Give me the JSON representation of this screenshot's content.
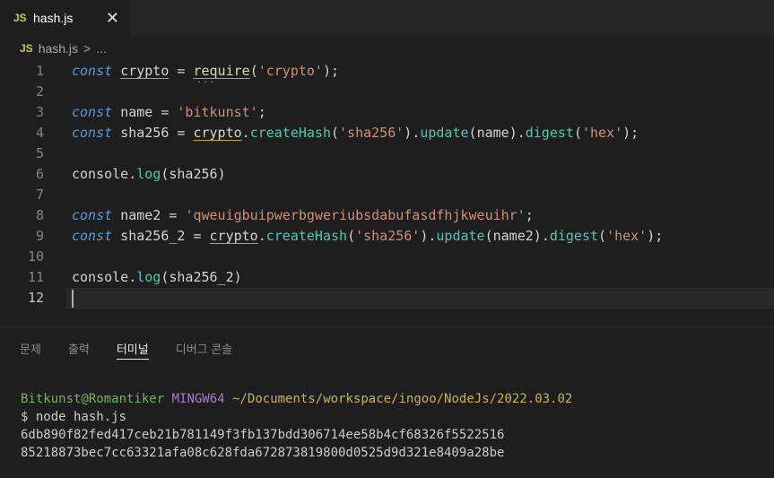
{
  "tab": {
    "badge": "JS",
    "title": "hash.js",
    "close": "✕"
  },
  "breadcrumb": {
    "badge": "JS",
    "file": "hash.js",
    "sep": ">",
    "more": "..."
  },
  "editor": {
    "lines": [
      {
        "n": "1"
      },
      {
        "n": "2"
      },
      {
        "n": "3"
      },
      {
        "n": "4"
      },
      {
        "n": "5"
      },
      {
        "n": "6"
      },
      {
        "n": "7"
      },
      {
        "n": "8"
      },
      {
        "n": "9"
      },
      {
        "n": "10"
      },
      {
        "n": "11"
      },
      {
        "n": "12"
      }
    ],
    "tokens": {
      "const": "const",
      "crypto": "crypto",
      "eq": " = ",
      "require": "require",
      "lp": "(",
      "rp": ")",
      "semi": ";",
      "str_crypto": "'crypto'",
      "name": "name",
      "str_bitkunst": "'bitkunst'",
      "sha256": "sha256",
      "dot": ".",
      "createHash": "createHash",
      "str_sha256": "'sha256'",
      "update": "update",
      "digest": "digest",
      "str_hex": "'hex'",
      "console": "console",
      "log": "log",
      "name2": "name2",
      "str_long": "'qweuigbuipwerbgweriubsdabufasdfhjkweuihr'",
      "sha256_2": "sha256_2",
      "dots": "..."
    }
  },
  "panel": {
    "tabs": [
      "문제",
      "출력",
      "터미널",
      "디버그 콘솔"
    ],
    "active_tab": "터미널"
  },
  "terminal": {
    "user": "Bitkunst@Romantiker",
    "system": "MINGW64",
    "path": "~/Documents/workspace/ingoo/NodeJs/2022.03.02",
    "command": "$ node hash.js",
    "outputs": [
      "6db890f82fed417ceb21b781149f3fb137bdd306714ee58b4cf68326f5522516",
      "85218873bec7cc63321afa08c628fda672873819800d0525d9d321e8409a28be"
    ]
  }
}
